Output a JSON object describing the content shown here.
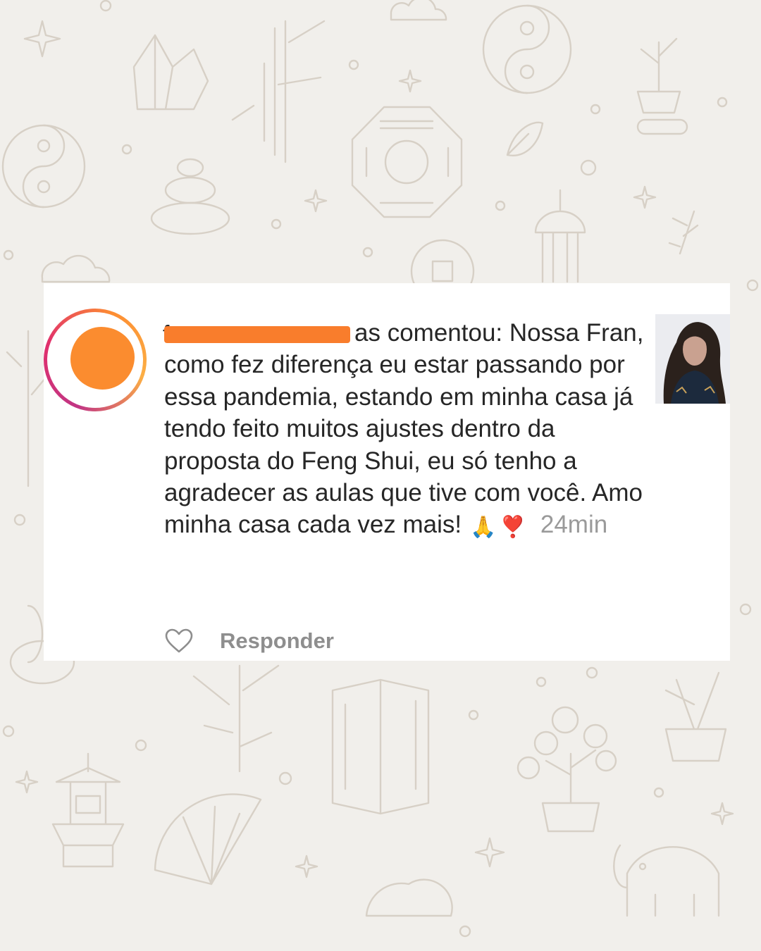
{
  "comment": {
    "username_visible_prefix": "f",
    "username_visible_suffix": "as",
    "action": "comentou:",
    "text": "Nossa Fran, como fez diferença eu estar passando por essa pandemia, estando em minha casa já tendo feito muitos ajustes dentro da proposta do Feng Shui, eu só tenho a agradecer as aulas que tive com você. Amo minha casa cada vez mais!",
    "emojis": [
      "🙏",
      "❣️"
    ],
    "timestamp": "24min",
    "reply_label": "Responder",
    "like_icon": "heart-outline-icon"
  },
  "colors": {
    "background": "#f1efeb",
    "card": "#ffffff",
    "redaction": "#f97d2c",
    "avatar_fill": "#fb8c2f",
    "text": "#262626",
    "muted": "#9a9a9a"
  }
}
